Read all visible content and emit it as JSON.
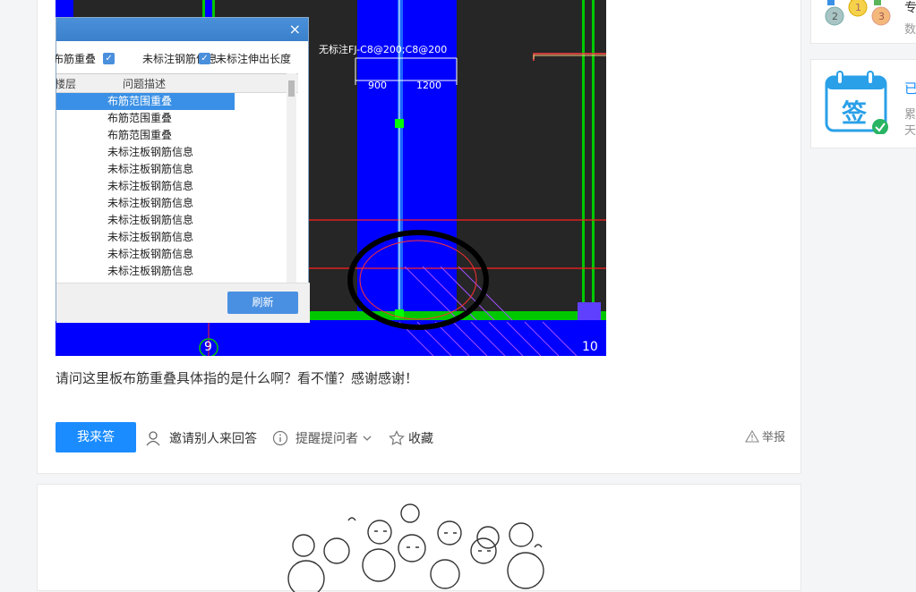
{
  "screenshot": {
    "annotation": "无标注FJ-C8@200;C8@200",
    "dim_left": "900",
    "dim_right": "1200",
    "axis_left": "9",
    "axis_right": "10"
  },
  "dialog": {
    "close_glyph": "×",
    "check1": "布筋重叠",
    "check2": "未标注钢筋信息",
    "check3": "未标注伸出长度",
    "col_floor": "楼层",
    "col_desc": "问题描述",
    "rows": [
      "布筋范围重叠",
      "布筋范围重叠",
      "布筋范围重叠",
      "未标注板钢筋信息",
      "未标注板钢筋信息",
      "未标注板钢筋信息",
      "未标注板钢筋信息",
      "未标注板钢筋信息",
      "未标注板钢筋信息",
      "未标注板钢筋信息",
      "未标注板钢筋信息"
    ],
    "refresh": "刷新"
  },
  "question": "请问这里板布筋重叠具体指的是什么啊？看不懂？感谢感谢！",
  "actions": {
    "answer": "我来答",
    "invite": "邀请别人来回答",
    "remind": "提醒提问者",
    "favorite": "收藏",
    "report": "举报"
  },
  "sidebar": {
    "medal_a": "专",
    "medal_b": "数",
    "sign_icon_char": "签",
    "sign_title": "已",
    "sign_sub1": "累",
    "sign_sub2": "天"
  },
  "colors": {
    "primary": "#1a8cff",
    "cad_blue": "#0000ff",
    "cad_green": "#00c800"
  }
}
